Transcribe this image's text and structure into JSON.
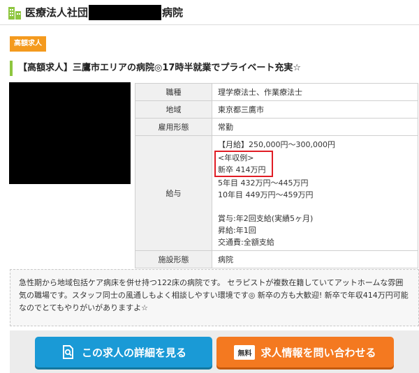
{
  "header": {
    "title_prefix": "医療法人社団",
    "title_suffix": "病院",
    "icon": "building-icon"
  },
  "badge": "高額求人",
  "job_title": "【高額求人】三鷹市エリアの病院◎17時半就業でプライベート充実☆",
  "table": {
    "rows": [
      {
        "label": "職種",
        "value": "理学療法士、作業療法士"
      },
      {
        "label": "地域",
        "value": "東京都三鷹市"
      },
      {
        "label": "雇用形態",
        "value": "常勤"
      }
    ],
    "salary_label": "給与",
    "salary": {
      "monthly": "【月給】250,000円～300,000円",
      "example_title": "<年収例>",
      "new_grad": "新卒 414万円",
      "year5": "5年目 432万円～445万円",
      "year10": "10年目 449万円～459万円",
      "bonus": "賞与:年2回支給(実績5ヶ月)",
      "raise": "昇給:年1回",
      "transport": "交通費:全額支給"
    },
    "facility_label": "施設形態",
    "facility_value": "病院"
  },
  "description": "急性期から地域包括ケア病床を併せ持つ122床の病院です。 セラピストが複数在籍していてアットホームな雰囲気の職場です。スタッフ同士の風通しもよく相談しやすい環境です◎ 新卒の方も大歓迎! 新卒で年収414万円可能なのでとてもやりがいがありますよ☆",
  "buttons": {
    "detail": "この求人の詳細を見る",
    "free_tag": "無料",
    "contact": "求人情報を問い合わせる"
  },
  "colors": {
    "badge": "#f49a1e",
    "accent_green": "#8ec63f",
    "detail_button": "#1a9ad6",
    "contact_button": "#f47920",
    "highlight_border": "#e01c24"
  }
}
